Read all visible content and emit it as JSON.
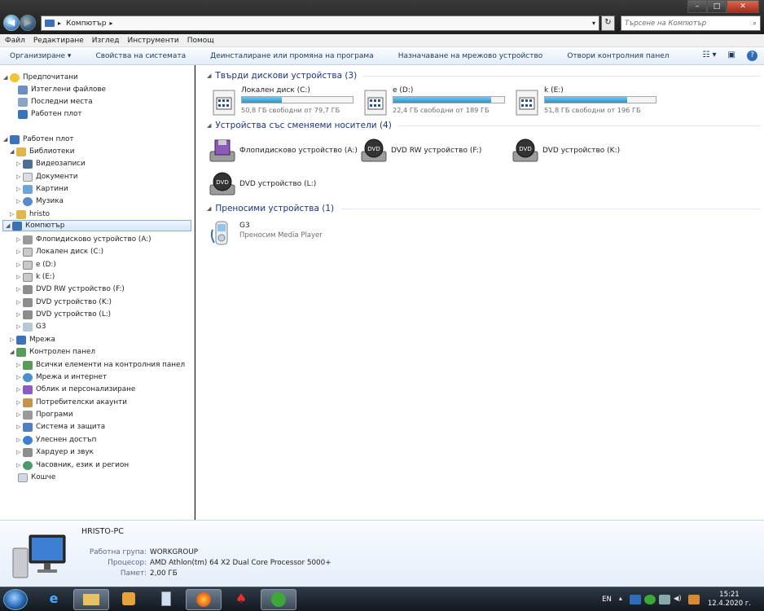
{
  "window": {
    "address_crumb": "Компютър",
    "search_placeholder": "Търсене на Компютър"
  },
  "menu": [
    "Файл",
    "Редактиране",
    "Изглед",
    "Инструменти",
    "Помощ"
  ],
  "commands": [
    "Организиране ▾",
    "Свойства на системата",
    "Деинсталиране или промяна на програма",
    "Назначаване на мрежово устройство",
    "Отвори контролния панел"
  ],
  "nav": {
    "favorites": "Предпочитани",
    "fav_items": [
      "Изтеглени файлове",
      "Последни места",
      "Работен плот"
    ],
    "desktop": "Работен плот",
    "libraries": "Библиотеки",
    "lib_items": [
      "Видеозаписи",
      "Документи",
      "Картини",
      "Музика"
    ],
    "user": "hristo",
    "computer": "Компютър",
    "computer_items": [
      "Флопидисково устройство (A:)",
      "Локален диск (C:)",
      "e (D:)",
      "k (E:)",
      "DVD RW устройство (F:)",
      "DVD устройство (K:)",
      "DVD устройство (L:)",
      "G3"
    ],
    "network": "Мрежа",
    "control_panel": "Контролен панел",
    "cp_items": [
      "Всички елементи на контролния панел",
      "Мрежа и интернет",
      "Облик и персонализиране",
      "Потребителски акаунти",
      "Програми",
      "Система и защита",
      "Улеснен достъп",
      "Хардуер и звук",
      "Часовник, език и регион"
    ],
    "recycle": "Кошче"
  },
  "groups": {
    "hdd": "Твърди дискови устройства (3)",
    "removable": "Устройства със сменяеми носители (4)",
    "portable": "Преносими устройства (1)"
  },
  "drives": [
    {
      "name": "Локален диск (C:)",
      "free": "50,8 ГБ свободни от 79,7 ГБ",
      "used_fraction": 0.36
    },
    {
      "name": "e (D:)",
      "free": "22,4 ГБ свободни от 189 ГБ",
      "used_fraction": 0.88
    },
    {
      "name": "k (E:)",
      "free": "51,8 ГБ свободни от 196 ГБ",
      "used_fraction": 0.74
    }
  ],
  "removable": [
    {
      "name": "Флопидисково устройство (A:)",
      "icon": "floppy-icon"
    },
    {
      "name": "DVD RW устройство (F:)",
      "icon": "dvd-icon"
    },
    {
      "name": "DVD устройство (K:)",
      "icon": "dvd-icon"
    },
    {
      "name": "DVD устройство (L:)",
      "icon": "dvd-icon"
    }
  ],
  "portable": {
    "name": "G3",
    "sub": "Преносим Media Player"
  },
  "details": {
    "pc_name": "HRISTO-PC",
    "workgroup_label": "Работна група:",
    "workgroup": "WORKGROUP",
    "cpu_label": "Процесор:",
    "cpu": "AMD Athlon(tm) 64 X2 Dual Core Processor 5000+",
    "mem_label": "Памет:",
    "mem": "2,00 ГБ"
  },
  "taskbar": {
    "lang": "EN",
    "time": "15:21",
    "date": "12.4.2020 г."
  },
  "colors": {
    "accent": "#1e3287",
    "bar": "#2a95c9"
  }
}
